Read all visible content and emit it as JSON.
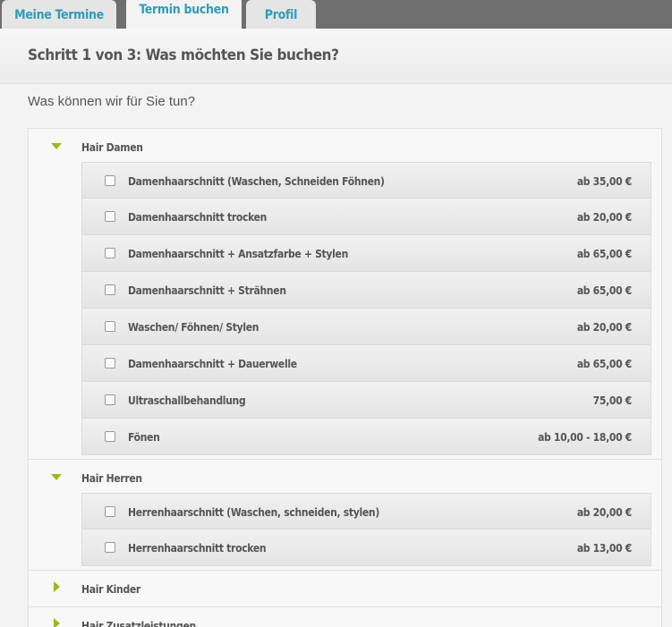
{
  "tabs": {
    "meine_termine": "Meine Termine",
    "termin_buchen": "Termin buchen",
    "profil": "Profil"
  },
  "step": {
    "title": "Schritt 1 von 3: Was möchten Sie buchen?",
    "question": "Was können wir für Sie tun?"
  },
  "categories": {
    "hair_damen": {
      "label": "Hair Damen",
      "expanded": true,
      "services": [
        {
          "name": "Damenhaarschnitt (Waschen, Schneiden Föhnen)",
          "price": "ab 35,00 €",
          "checked": false
        },
        {
          "name": "Damenhaarschnitt trocken",
          "price": "ab 20,00 €",
          "checked": false
        },
        {
          "name": "Damenhaarschnitt + Ansatzfarbe + Stylen",
          "price": "ab 65,00 €",
          "checked": false
        },
        {
          "name": "Damenhaarschnitt + Strähnen",
          "price": "ab 65,00 €",
          "checked": false
        },
        {
          "name": "Waschen/ Föhnen/ Stylen",
          "price": "ab 20,00 €",
          "checked": false
        },
        {
          "name": "Damenhaarschnitt + Dauerwelle",
          "price": "ab 65,00 €",
          "checked": false
        },
        {
          "name": "Ultraschallbehandlung",
          "price": "75,00 €",
          "checked": false
        },
        {
          "name": "Fönen",
          "price": "ab 10,00 - 18,00 €",
          "checked": false
        }
      ]
    },
    "hair_herren": {
      "label": "Hair Herren",
      "expanded": true,
      "services": [
        {
          "name": "Herrenhaarschnitt (Waschen, schneiden, stylen)",
          "price": "ab 20,00 €",
          "checked": false
        },
        {
          "name": "Herrenhaarschnitt trocken",
          "price": "ab 13,00 €",
          "checked": false
        }
      ]
    },
    "hair_kinder": {
      "label": "Hair Kinder",
      "expanded": false
    },
    "hair_zusatz": {
      "label": "Hair Zusatzleistungen",
      "expanded": false
    }
  },
  "colors": {
    "tab_text": "#2d9cb8",
    "tabbar_bg": "#6f6f6f",
    "expand_arrow": "#9cb81a"
  }
}
